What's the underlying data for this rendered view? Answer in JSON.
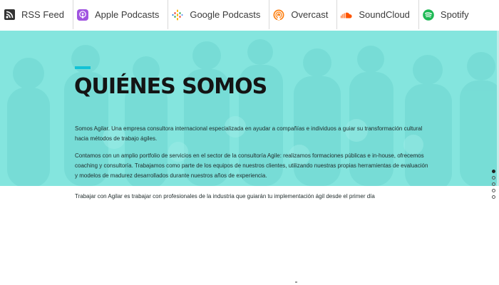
{
  "podcast_bar": {
    "items": [
      {
        "label": "RSS Feed",
        "icon": "rss-icon",
        "color": "#2b2b2b"
      },
      {
        "label": "Apple Podcasts",
        "icon": "apple-podcasts-icon",
        "color": "#9b4fd6"
      },
      {
        "label": "Google Podcasts",
        "icon": "google-podcasts-icon",
        "color": "#4285f4"
      },
      {
        "label": "Overcast",
        "icon": "overcast-icon",
        "color": "#fc7e0f"
      },
      {
        "label": "SoundCloud",
        "icon": "soundcloud-icon",
        "color": "#ff5500"
      },
      {
        "label": "Spotify",
        "icon": "spotify-icon",
        "color": "#1db954"
      }
    ]
  },
  "hero": {
    "title": "QUIÉNES SOMOS",
    "accent_color": "#13c2d6",
    "overlay_color": "#7ee3dc",
    "paragraphs": [
      "Somos Agilar. Una empresa consultora internacional especializada en ayudar a compañías e individuos a guiar su transformación cultural hacia métodos de trabajo ágiles.",
      "Contamos con un amplio portfolio de servicios en el sector de la consultoría Agile: realizamos formaciones públicas e in-house, ofrecemos coaching y consultoría. Trabajamos como parte de los equipos de nuestros clientes, utilizando nuestras propias herramientas de evaluación y modelos de madurez desarrollados durante nuestros años de experiencia.",
      "Trabajar con Agilar es trabajar con profesionales de la industria que guiarán tu implementación ágil desde el primer día"
    ]
  },
  "slider": {
    "dots": 5,
    "active_index": 0
  }
}
